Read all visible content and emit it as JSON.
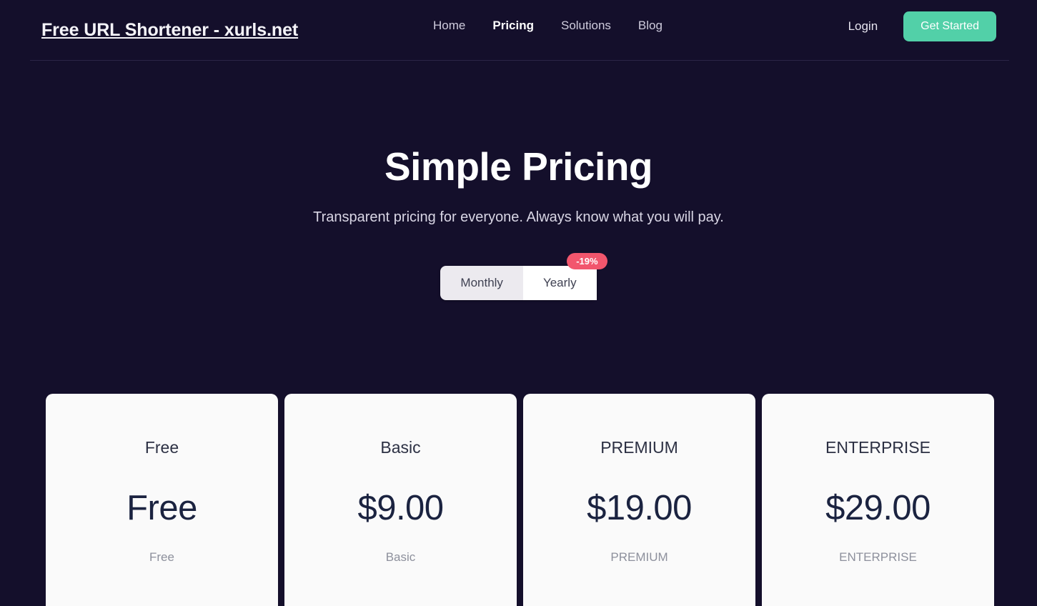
{
  "header": {
    "brand": "Free URL Shortener - xurls.net",
    "nav": [
      {
        "label": "Home",
        "active": false
      },
      {
        "label": "Pricing",
        "active": true
      },
      {
        "label": "Solutions",
        "active": false
      },
      {
        "label": "Blog",
        "active": false
      }
    ],
    "login_label": "Login",
    "get_started_label": "Get Started",
    "accent_color": "#52d0a8"
  },
  "hero": {
    "title": "Simple Pricing",
    "subtitle": "Transparent pricing for everyone. Always know what you will pay."
  },
  "billing_toggle": {
    "monthly_label": "Monthly",
    "yearly_label": "Yearly",
    "selected": "Monthly",
    "discount_badge": "-19%",
    "badge_color": "#f2566d"
  },
  "pricing": {
    "plans": [
      {
        "name": "Free",
        "price": "Free",
        "caption": "Free"
      },
      {
        "name": "Basic",
        "price": "$9.00",
        "caption": "Basic"
      },
      {
        "name": "PREMIUM",
        "price": "$19.00",
        "caption": "PREMIUM"
      },
      {
        "name": "ENTERPRISE",
        "price": "$29.00",
        "caption": "ENTERPRISE"
      }
    ]
  },
  "theme": {
    "background": "#140f2b",
    "card_background": "#fafafa",
    "divider": "#2b2547"
  }
}
